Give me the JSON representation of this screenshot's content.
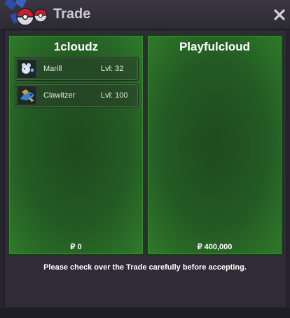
{
  "window": {
    "title": "Trade",
    "close_icon": "close-icon",
    "logo_icon": "pokeball-logo-icon"
  },
  "colors": {
    "panel_green": "#235a23",
    "panel_border": "#1a3a18",
    "title_text": "#c9c8cf",
    "background": "#2f2c38"
  },
  "left_panel": {
    "player_name": "1cloudz",
    "money": "₽ 0",
    "pokemon": [
      {
        "name": "Marill",
        "level": "Lvl: 32",
        "icon": "marill-sprite-icon"
      },
      {
        "name": "Clawitzer",
        "level": "Lvl: 100",
        "icon": "clawitzer-sprite-icon"
      }
    ]
  },
  "right_panel": {
    "player_name": "Playfulcloud",
    "money": "₽ 400,000",
    "pokemon": []
  },
  "notice": "Please check over the Trade carefully before accepting."
}
